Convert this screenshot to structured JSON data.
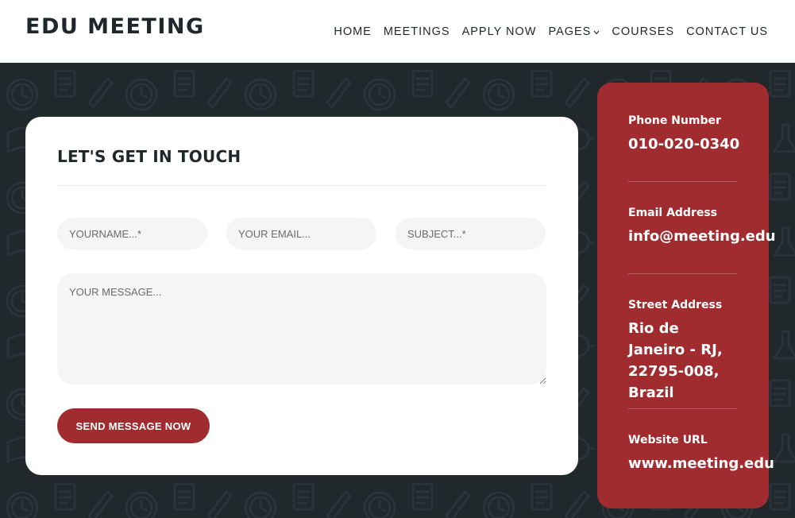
{
  "header": {
    "logo": "EDU MEETING",
    "nav": [
      "HOME",
      "MEETINGS",
      "APPLY NOW",
      "PAGES",
      "COURSES",
      "CONTACT US"
    ]
  },
  "contact_form": {
    "title": "LET'S GET IN TOUCH",
    "name_placeholder": "YOURNAME...*",
    "email_placeholder": "YOUR EMAIL...",
    "subject_placeholder": "SUBJECT...*",
    "message_placeholder": "YOUR MESSAGE...",
    "submit_label": "SEND MESSAGE NOW"
  },
  "contact_info": {
    "phone_label": "Phone Number",
    "phone": "010-020-0340",
    "email_label": "Email Address",
    "email": "info@meeting.edu",
    "address_label": "Street Address",
    "address": "Rio de Janeiro - RJ, 22795-008, Brazil",
    "website_label": "Website URL",
    "website": "www.meeting.edu"
  },
  "colors": {
    "accent": "#a12c2f",
    "background_dark": "#1f272b",
    "header_bg": "#ffffff",
    "input_bg": "#f5f5f5"
  },
  "icons": [
    "chevron-down-icon",
    "education-doodle-pattern"
  ]
}
